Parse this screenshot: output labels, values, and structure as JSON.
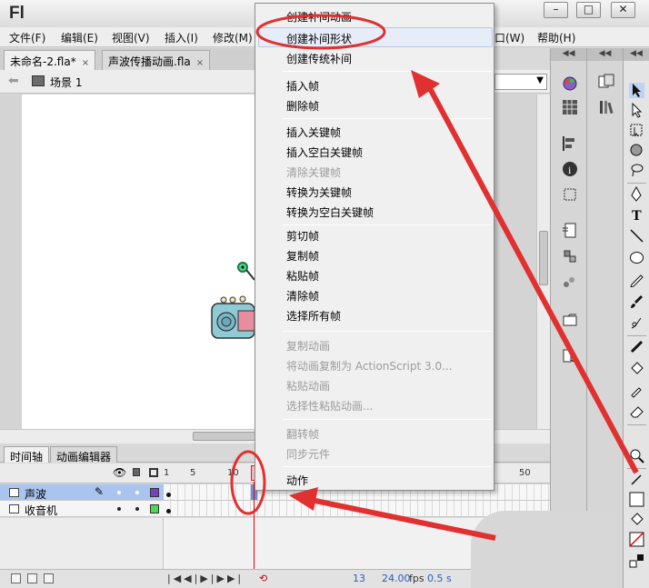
{
  "app": {
    "logo": "Fl"
  },
  "window_buttons": {
    "minimize": "–",
    "restore": "□",
    "close": "✕"
  },
  "menubar": {
    "items": [
      "文件(F)",
      "编辑(E)",
      "视图(V)",
      "插入(I)",
      "修改(M)"
    ],
    "right_items": [
      "口(W)",
      "帮助(H)"
    ]
  },
  "doc_tabs": [
    {
      "label": "未命名-2.fla*",
      "close": "×"
    },
    {
      "label": "声波传播动画.fla",
      "close": "×"
    }
  ],
  "scene": {
    "label": "场景 1"
  },
  "context_menu": {
    "items": [
      {
        "label": "创建补间动画",
        "disabled": false
      },
      {
        "label": "创建补间形状",
        "disabled": false,
        "highlighted": true
      },
      {
        "label": "创建传统补间",
        "disabled": false
      },
      {
        "label": "插入帧",
        "disabled": false
      },
      {
        "label": "删除帧",
        "disabled": false
      },
      {
        "label": "插入关键帧",
        "disabled": false
      },
      {
        "label": "插入空白关键帧",
        "disabled": false
      },
      {
        "label": "清除关键帧",
        "disabled": true
      },
      {
        "label": "转换为关键帧",
        "disabled": false
      },
      {
        "label": "转换为空白关键帧",
        "disabled": false
      },
      {
        "label": "剪切帧",
        "disabled": false
      },
      {
        "label": "复制帧",
        "disabled": false
      },
      {
        "label": "粘贴帧",
        "disabled": false
      },
      {
        "label": "清除帧",
        "disabled": false
      },
      {
        "label": "选择所有帧",
        "disabled": false
      },
      {
        "label": "复制动画",
        "disabled": true
      },
      {
        "label": "将动画复制为 ActionScript 3.0...",
        "disabled": true
      },
      {
        "label": "粘贴动画",
        "disabled": true
      },
      {
        "label": "选择性粘贴动画...",
        "disabled": true
      },
      {
        "label": "翻转帧",
        "disabled": true
      },
      {
        "label": "同步元件",
        "disabled": true
      },
      {
        "label": "动作",
        "disabled": false
      }
    ]
  },
  "timeline": {
    "tabs": [
      "时间轴",
      "动画编辑器"
    ],
    "ruler_labels": [
      "1",
      "5",
      "10",
      "50"
    ],
    "layers": [
      {
        "name": "声波",
        "selected": true,
        "color": "#7a3fc0"
      },
      {
        "name": "收音机",
        "selected": false,
        "color": "#4fd84f"
      }
    ],
    "footer": {
      "current_frame": "13",
      "fps": "24.00",
      "fps_unit": "fps",
      "time": "0.5 s"
    }
  },
  "colors": {
    "annotation_red": "#e0302f",
    "highlight_blue": "#e7edf8",
    "selected_layer": "#a9c4ef"
  },
  "icons": {
    "tools": [
      "selection-tool-icon",
      "subselection-tool-icon",
      "free-transform-icon",
      "3d-rotation-icon",
      "lasso-icon",
      "pen-icon",
      "text-tool-icon",
      "line-tool-icon",
      "oval-tool-icon",
      "pencil-icon",
      "brush-icon",
      "deco-icon",
      "bone-icon",
      "paint-bucket-icon",
      "eyedropper-icon",
      "eraser-icon",
      "zoom-icon",
      "stroke-color-icon",
      "fill-color-icon",
      "swap-colors-icon"
    ]
  }
}
